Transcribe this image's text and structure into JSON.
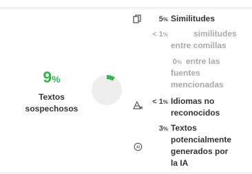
{
  "summary": {
    "score_value": "9",
    "score_unit": "%",
    "score_label_line1": "Textos",
    "score_label_line2": "sospechosos",
    "score_fraction": 0.09,
    "accent_color": "#2fb84a"
  },
  "metrics": [
    {
      "icon": "copy-icon",
      "pct_prefix": "",
      "pct": "5",
      "unit": "%",
      "lines": [
        "Similitudes"
      ]
    },
    {
      "icon": "",
      "pct_prefix": "< ",
      "pct": "1",
      "unit": "%",
      "lines": [
        "similitudes",
        "entre comillas"
      ]
    },
    {
      "icon": "",
      "pct_prefix": "",
      "pct": "0",
      "unit": "%",
      "lines": [
        "entre las",
        "fuentes",
        "mencionadas"
      ]
    },
    {
      "icon": "translate-icon",
      "pct_prefix": "< ",
      "pct": "1",
      "unit": "%",
      "lines": [
        "Idiomas no",
        "reconocidos"
      ]
    },
    {
      "icon": "ai-chip-icon",
      "pct_prefix": "",
      "pct": "3",
      "unit": "%",
      "lines": [
        "Textos",
        "potencialmente",
        "generados por",
        "la IA"
      ]
    }
  ]
}
